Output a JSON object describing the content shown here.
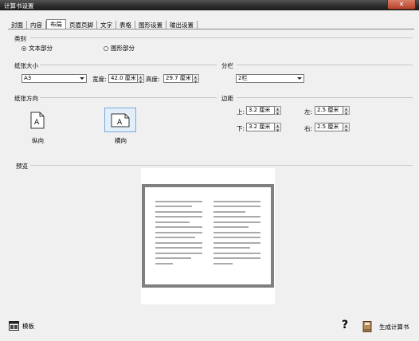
{
  "window": {
    "title": "计算书设置",
    "close_symbol": "✕"
  },
  "tabs": [
    "封面",
    "内容",
    "布局",
    "页眉页脚",
    "文字",
    "表格",
    "图形设置",
    "输出设置"
  ],
  "active_tab": "布局",
  "category": {
    "label": "类别",
    "options": [
      {
        "label": "文本部分",
        "selected": true
      },
      {
        "label": "图形部分",
        "selected": false
      }
    ]
  },
  "paper_size": {
    "label": "纸张大小",
    "selected": "A3",
    "width_label": "宽度:",
    "width_value": "42.0 厘米",
    "height_label": "高度:",
    "height_value": "29.7 厘米"
  },
  "columns": {
    "label": "分栏",
    "selected": "2栏"
  },
  "orientation": {
    "label": "纸张方向",
    "portrait_label": "纵向",
    "landscape_label": "横向",
    "selected": "landscape",
    "icon_letter": "A"
  },
  "margins": {
    "label": "边距",
    "top_label": "上:",
    "top_value": "3.2 厘米",
    "left_label": "左:",
    "left_value": "2.5 厘米",
    "bottom_label": "下:",
    "bottom_value": "3.2 厘米",
    "right_label": "右:",
    "right_value": "2.5 厘米"
  },
  "preview": {
    "label": "预览"
  },
  "footer": {
    "template_label": "模板",
    "help_symbol": "?",
    "generate_label": "生成计算书"
  }
}
